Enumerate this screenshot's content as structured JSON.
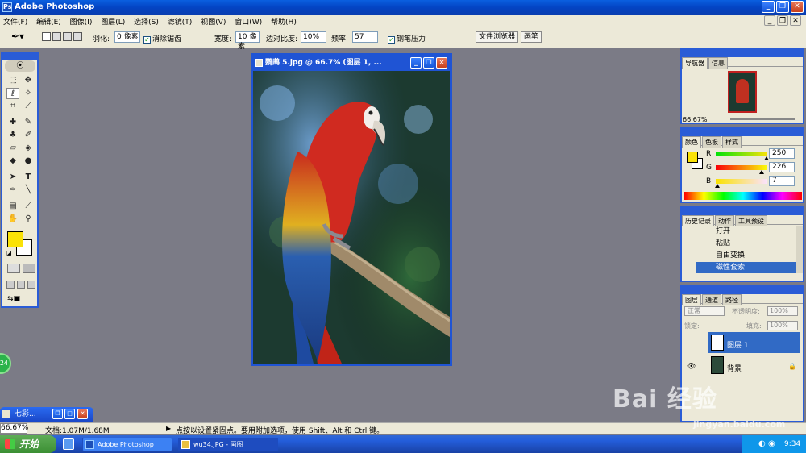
{
  "window": {
    "title": "Adobe Photoshop"
  },
  "menu": [
    "文件(F)",
    "编辑(E)",
    "图像(I)",
    "图层(L)",
    "选择(S)",
    "滤镜(T)",
    "视图(V)",
    "窗口(W)",
    "帮助(H)"
  ],
  "options": {
    "feather_label": "羽化:",
    "feather_value": "0 像素",
    "antialias_label": "消除锯齿",
    "width_label": "宽度:",
    "width_value": "10 像素",
    "edge_label": "边对比度:",
    "edge_value": "10%",
    "freq_label": "频率:",
    "freq_value": "57",
    "pen_pressure_label": "钢笔压力",
    "file_browser_tab": "文件浏览器",
    "brushes_tab": "画笔"
  },
  "document": {
    "title": "鹦鹉 5.jpg @ 66.7% (图层 1, ..."
  },
  "navigator": {
    "tabs": [
      "导航器",
      "信息"
    ],
    "zoom": "66.67%"
  },
  "color": {
    "tabs": [
      "颜色",
      "色板",
      "样式"
    ],
    "r_label": "R",
    "g_label": "G",
    "b_label": "B",
    "r": "250",
    "g": "226",
    "b": "7",
    "r_frac": 0.98,
    "g_frac": 0.886,
    "b_frac": 0.027,
    "fg": "#fae207"
  },
  "history": {
    "tabs": [
      "历史记录",
      "动作",
      "工具预设"
    ],
    "items": [
      "打开",
      "粘贴",
      "自由变换",
      "磁性套索"
    ]
  },
  "layers": {
    "tabs": [
      "图层",
      "通道",
      "路径"
    ],
    "blend_mode": "正常",
    "opacity_label": "不透明度:",
    "opacity": "100%",
    "lock_label": "锁定:",
    "fill_label": "填充:",
    "fill": "100%",
    "items": [
      "图层 1",
      "背景"
    ]
  },
  "status": {
    "zoom": "66.67%",
    "doc": "文档:1.07M/1.68M",
    "hint": "点按以设置紧固点。要用附加选项，使用 Shift、Alt 和 Ctrl 键。"
  },
  "minimized": {
    "title": "七彩..."
  },
  "taskbar": {
    "start": "开始",
    "tasks": [
      "Adobe Photoshop",
      "wu34.JPG - 画图"
    ],
    "time": "9:34"
  },
  "watermark": {
    "logo": "Bai 经验",
    "url": "jingyan.baidu.com"
  }
}
